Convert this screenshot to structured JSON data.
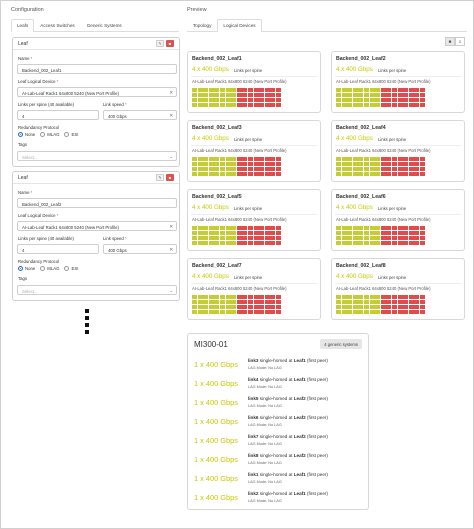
{
  "left": {
    "section_title": "Configuration",
    "tabs": [
      {
        "label": "Leafs",
        "active": true
      },
      {
        "label": "Access Switches",
        "active": false
      },
      {
        "label": "Generic Systems",
        "active": false
      }
    ],
    "cards": [
      {
        "title": "Leaf",
        "name_label": "Name",
        "name_value": "Backend_002_Leaf1",
        "device_label": "Leaf Logical Device",
        "device_value": "AI-Lab-Leaf Rack1 64x800 5240 (New Port Profile)",
        "links_label": "Links per spine (40 available)",
        "links_value": "4",
        "speed_label": "Link speed",
        "speed_value": "400 Gbps",
        "redundancy_label": "Redundancy Protocol",
        "redundancy_options": [
          "None",
          "MLAG",
          "ESI"
        ],
        "redundancy_selected": "None",
        "tags_label": "Tags",
        "tags_placeholder": "Select..."
      },
      {
        "title": "Leaf",
        "name_label": "Name",
        "name_value": "Backend_002_Leaf2",
        "device_label": "Leaf Logical Device",
        "device_value": "AI-Lab-Leaf Rack1 64x800 5240 (New Port Profile)",
        "links_label": "Links per spine (40 available)",
        "links_value": "4",
        "speed_label": "Link speed",
        "speed_value": "400 Gbps",
        "redundancy_label": "Redundancy Protocol",
        "redundancy_options": [
          "None",
          "MLAG",
          "ESI"
        ],
        "redundancy_selected": "None",
        "tags_label": "Tags",
        "tags_placeholder": "Select..."
      }
    ]
  },
  "right": {
    "section_title": "Preview",
    "tabs": [
      {
        "label": "Topology",
        "active": false
      },
      {
        "label": "Logical Devices",
        "active": true
      }
    ],
    "devices": [
      {
        "name": "Backend_002_Leaf1",
        "speed": "4 x 400 Gbps",
        "per": "Links per spine",
        "profile": "AI-Lab-Leaf Rack1 64x800 5240 (New Port Profile)"
      },
      {
        "name": "Backend_002_Leaf2",
        "speed": "4 x 400 Gbps",
        "per": "Links per spine",
        "profile": "AI-Lab-Leaf Rack1 64x800 5240 (New Port Profile)"
      },
      {
        "name": "Backend_002_Leaf3",
        "speed": "4 x 400 Gbps",
        "per": "Links per spine",
        "profile": "AI-Lab-Leaf Rack1 64x800 5240 (New Port Profile)"
      },
      {
        "name": "Backend_002_Leaf4",
        "speed": "4 x 400 Gbps",
        "per": "Links per spine",
        "profile": "AI-Lab-Leaf Rack1 64x800 5240 (New Port Profile)"
      },
      {
        "name": "Backend_002_Leaf5",
        "speed": "4 x 400 Gbps",
        "per": "Links per spine",
        "profile": "AI-Lab-Leaf Rack1 64x800 5240 (New Port Profile)"
      },
      {
        "name": "Backend_002_Leaf6",
        "speed": "4 x 400 Gbps",
        "per": "Links per spine",
        "profile": "AI-Lab-Leaf Rack1 64x800 5240 (New Port Profile)"
      },
      {
        "name": "Backend_002_Leaf7",
        "speed": "4 x 400 Gbps",
        "per": "Links per spine",
        "profile": "AI-Lab-Leaf Rack1 64x800 5240 (New Port Profile)"
      },
      {
        "name": "Backend_002_Leaf8",
        "speed": "4 x 400 Gbps",
        "per": "Links per spine",
        "profile": "AI-Lab-Leaf Rack1 64x800 5240 (New Port Profile)"
      }
    ],
    "port_colors": {
      "up": "#c6cc33",
      "down": "#e34a4a"
    },
    "generic": {
      "name": "MI300-01",
      "badge": "4 generic systems",
      "links": [
        {
          "speed": "1 x 400 Gbps",
          "link": "link3",
          "mid": " single-homed at ",
          "leaf": "Leaf1",
          "tail": " (first peer)",
          "lag": "LAG Mode: No LAG"
        },
        {
          "speed": "1 x 400 Gbps",
          "link": "link4",
          "mid": " single-homed at ",
          "leaf": "Leaf1",
          "tail": " (first peer)",
          "lag": "LAG Mode: No LAG"
        },
        {
          "speed": "1 x 400 Gbps",
          "link": "link5",
          "mid": " single-homed at ",
          "leaf": "Leaf2",
          "tail": " (first peer)",
          "lag": "LAG Mode: No LAG"
        },
        {
          "speed": "1 x 400 Gbps",
          "link": "link6",
          "mid": " single-homed at ",
          "leaf": "Leaf2",
          "tail": " (first peer)",
          "lag": "LAG Mode: No LAG"
        },
        {
          "speed": "1 x 400 Gbps",
          "link": "link7",
          "mid": " single-homed at ",
          "leaf": "Leaf2",
          "tail": " (first peer)",
          "lag": "LAG Mode: No LAG"
        },
        {
          "speed": "1 x 400 Gbps",
          "link": "link8",
          "mid": " single-homed at ",
          "leaf": "Leaf2",
          "tail": " (first peer)",
          "lag": "LAG Mode: No LAG"
        },
        {
          "speed": "1 x 400 Gbps",
          "link": "link1",
          "mid": " single-homed at ",
          "leaf": "Leaf1",
          "tail": " (first peer)",
          "lag": "LAG Mode: No LAG"
        },
        {
          "speed": "1 x 400 Gbps",
          "link": "link2",
          "mid": " single-homed at ",
          "leaf": "Leaf1",
          "tail": " (first peer)",
          "lag": "LAG Mode: No LAG"
        }
      ]
    }
  }
}
